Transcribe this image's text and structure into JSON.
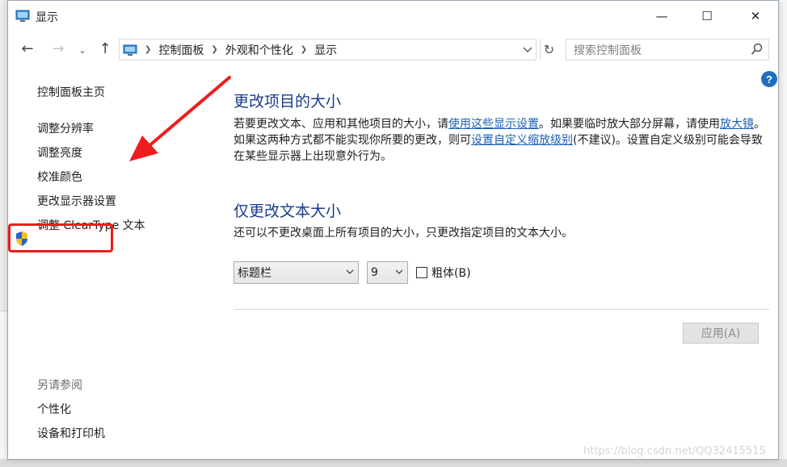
{
  "window": {
    "title": "显示",
    "controls": {
      "minimize": "—",
      "maximize": "☐",
      "close": "✕"
    }
  },
  "address_bar": {
    "breadcrumbs": [
      "控制面板",
      "外观和个性化",
      "显示"
    ],
    "search_placeholder": "搜索控制面板"
  },
  "help_label": "?",
  "sidebar": {
    "home": "控制面板主页",
    "items": [
      "调整分辨率",
      "调整亮度",
      "校准颜色",
      "更改显示器设置",
      "调整 ClearType 文本"
    ],
    "see_also_header": "另请参阅",
    "see_also": [
      "个性化",
      "设备和打印机"
    ]
  },
  "main": {
    "size_section": {
      "heading": "更改项目的大小",
      "text_1": "若要更改文本、应用和其他项目的大小，请",
      "link_1": "使用这些显示设置",
      "text_2": "。如果要临时放大部分屏幕，请使用",
      "link_2": "放大镜",
      "text_3": "。如果这两种方式都不能实现你所要的更改，则可",
      "link_3": "设置自定义缩放级别",
      "text_4": "(不建议)。设置自定义级别可能会导致在某些显示器上出现意外行为。"
    },
    "text_section": {
      "heading": "仅更改文本大小",
      "description": "还可以不更改桌面上所有项目的大小，只更改指定项目的文本大小。",
      "item_select": "标题栏",
      "size_select": "9",
      "bold_label": "粗体(B)",
      "bold_checked": false
    },
    "apply_label": "应用(A)"
  },
  "annotation": {
    "color": "#ee1c1c"
  },
  "watermark": "https://blog.csdn.net/QQ32415515"
}
